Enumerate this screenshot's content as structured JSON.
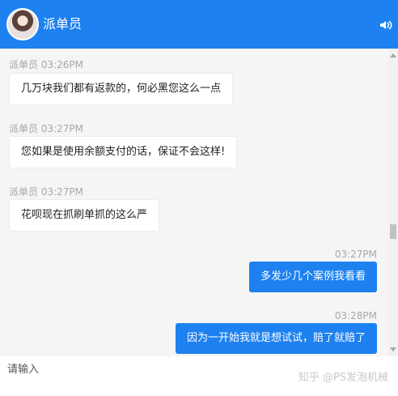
{
  "header": {
    "title": "派单员",
    "sound_icon": "speaker-icon",
    "avatar": "avatar"
  },
  "messages": [
    {
      "direction": "incoming",
      "sender": "派单员",
      "time": "03:26PM",
      "text": "几万块我们都有返款的，何必黑您这么一点"
    },
    {
      "direction": "incoming",
      "sender": "派单员",
      "time": "03:27PM",
      "text": "您如果是使用余额支付的话，保证不会这样!"
    },
    {
      "direction": "incoming",
      "sender": "派单员",
      "time": "03:27PM",
      "text": "花呗现在抓刷单抓的这么严"
    },
    {
      "direction": "outgoing",
      "time": "03:27PM",
      "text": "多发少几个案例我看看"
    },
    {
      "direction": "outgoing",
      "time": "03:28PM",
      "text": "因为一开始我就是想试试，赔了就赔了"
    }
  ],
  "input": {
    "placeholder": "请输入"
  },
  "watermark": "知乎 @PS发泡机械",
  "colors": {
    "accent": "#1d81f0",
    "chat_background": "#f5f5f5",
    "meta_text": "#a8a8a8"
  }
}
